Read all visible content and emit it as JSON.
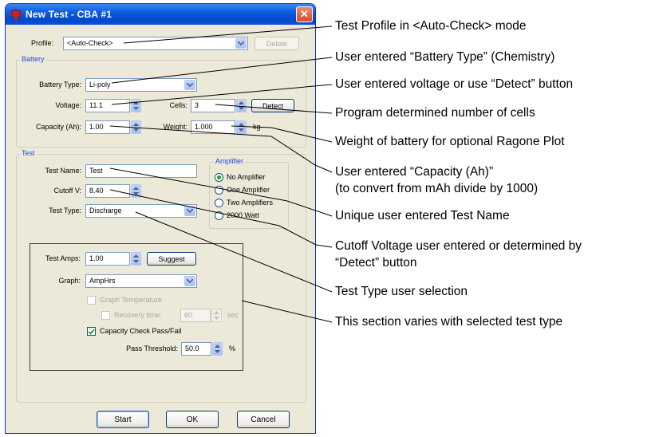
{
  "window": {
    "title": "New Test - CBA #1",
    "app_icon": "red-plus-icon",
    "close_glyph": "✕"
  },
  "profile": {
    "label": "Profile:",
    "value": "<Auto-Check>",
    "delete_label": "Delete"
  },
  "battery": {
    "group_title": "Battery",
    "type_label": "Battery Type:",
    "type_value": "Li-poly",
    "voltage_label": "Voltage:",
    "voltage_value": "11.1",
    "cells_label": "Cells:",
    "cells_value": "3",
    "detect_label": "Detect",
    "capacity_label": "Capacity (Ah):",
    "capacity_value": "1.00",
    "weight_label": "Weight:",
    "weight_value": "1.000",
    "weight_unit": "kg"
  },
  "test": {
    "group_title": "Test",
    "name_label": "Test Name:",
    "name_value": "Test",
    "cutoff_label": "Cutoff V:",
    "cutoff_value": "8.40",
    "type_label": "Test Type:",
    "type_value": "Discharge"
  },
  "amplifier": {
    "group_title": "Amplifier",
    "options": [
      "No Amplifier",
      "One Amplifier",
      "Two Amplifiers",
      "2000 Watt"
    ],
    "selected": "No Amplifier"
  },
  "section": {
    "amps_label": "Test Amps:",
    "amps_value": "1.00",
    "suggest_label": "Suggest",
    "graph_label": "Graph:",
    "graph_value": "AmpHrs",
    "graph_temp_label": "Graph Temperature",
    "recovery_label": "Recovery time:",
    "recovery_value": "60",
    "recovery_unit": "sec",
    "capacity_check_label": "Capacity Check Pass/Fail",
    "capacity_check_checked": true,
    "pass_threshold_label": "Pass Threshold:",
    "pass_threshold_value": "50.0",
    "pass_threshold_unit": "%"
  },
  "buttons": {
    "start": "Start",
    "ok": "OK",
    "cancel": "Cancel"
  },
  "callouts": {
    "c1": "Test Profile in <Auto-Check> mode",
    "c2": "User entered “Battery Type” (Chemistry)",
    "c3": "User entered voltage or use “Detect” button",
    "c4": "Program determined number of cells",
    "c5": "Weight of battery for optional Ragone Plot",
    "c6a": "User entered “Capacity (Ah)”",
    "c6b": "(to convert from mAh divide by 1000)",
    "c7": "Unique user entered Test Name",
    "c8a": "Cutoff Voltage user entered or determined by",
    "c8b": "“Detect” button",
    "c9": "Test Type user selection",
    "c10": "This section varies with selected test type"
  },
  "colors": {
    "titlebar": "#0a5ce0",
    "dialog_bg": "#ece9d8",
    "group_title": "#2a4ad8",
    "close_button": "#d8492b"
  }
}
